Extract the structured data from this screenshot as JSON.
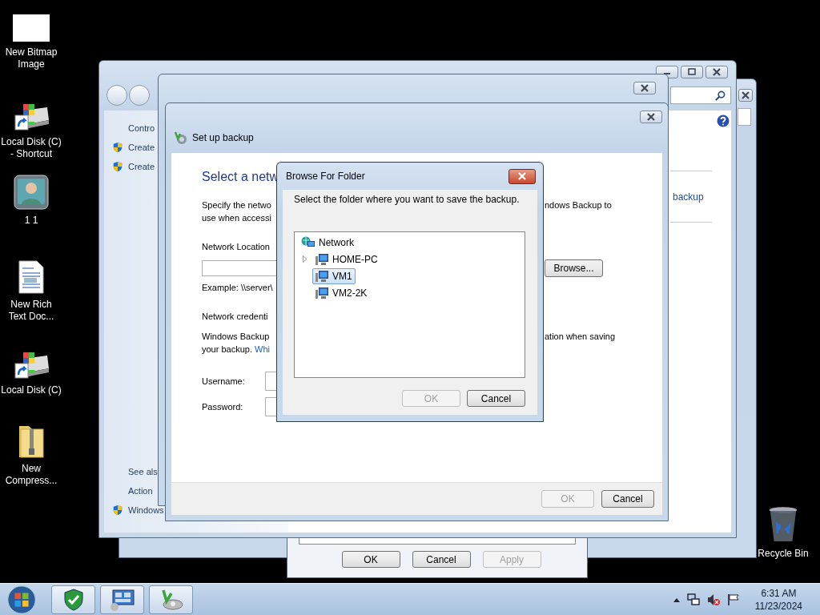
{
  "desktop_icons": [
    {
      "label": "New Bitmap Image",
      "kind": "bitmap"
    },
    {
      "label": "Local Disk (C) - Shortcut",
      "kind": "disk_shortcut"
    },
    {
      "label": "1 1",
      "kind": "user"
    },
    {
      "label": "New Rich Text Doc...",
      "kind": "document"
    },
    {
      "label": "Local Disk (C)",
      "kind": "disk_shortcut"
    },
    {
      "label": "New Compress...",
      "kind": "zip"
    },
    {
      "label": "Recycle Bin",
      "kind": "recycle"
    }
  ],
  "properties_window": {
    "buttons": [
      {
        "label": "OK",
        "disabled": false
      },
      {
        "label": "Cancel",
        "disabled": false
      },
      {
        "label": "Apply",
        "disabled": true
      }
    ]
  },
  "control_panel": {
    "nav_top": [
      {
        "text": "Contro",
        "shield": false
      },
      {
        "text": "Create",
        "shield": true
      },
      {
        "text": "Create",
        "shield": true
      }
    ],
    "nav_bottom": [
      {
        "text": "See als",
        "shield": false
      },
      {
        "text": "Action",
        "shield": false
      },
      {
        "text": "Windows",
        "shield": true
      }
    ],
    "link": "backup"
  },
  "setup_backup": {
    "title": "Set up backup",
    "heading": "Select a netw",
    "rows": [
      {
        "kind": "text",
        "left": "Specify the netwo",
        "right": "ndows Backup to"
      },
      {
        "kind": "text",
        "left": "use when accessi"
      },
      {
        "kind": "label",
        "left": "Network Location"
      },
      {
        "kind": "field_browse",
        "button": "Browse..."
      },
      {
        "kind": "text",
        "left": "Example: \\\\server\\"
      },
      {
        "kind": "label",
        "left": "Network credenti"
      },
      {
        "kind": "text",
        "left": "Windows Backup",
        "right": "ation when saving"
      },
      {
        "kind": "link",
        "left": "your backup.",
        "link": "Whi"
      },
      {
        "kind": "input",
        "left": "Username:"
      },
      {
        "kind": "input",
        "left": "Password:"
      }
    ],
    "buttons": [
      {
        "label": "OK",
        "disabled": true
      },
      {
        "label": "Cancel",
        "disabled": false
      }
    ]
  },
  "browse_dialog": {
    "title": "Browse For Folder",
    "instruction": "Select the folder where you want to save the backup.",
    "tree": {
      "label": "Network",
      "kind": "network",
      "selected": false,
      "children": [
        {
          "label": "HOME-PC",
          "kind": "computer",
          "expandable": true,
          "selected": false
        },
        {
          "label": "VM1",
          "kind": "computer",
          "expandable": false,
          "selected": true
        },
        {
          "label": "VM2-2K",
          "kind": "computer",
          "expandable": false,
          "selected": false
        }
      ]
    },
    "buttons": [
      {
        "label": "OK",
        "disabled": true
      },
      {
        "label": "Cancel",
        "disabled": false
      }
    ]
  },
  "taskbar": {
    "apps": [
      {
        "kind": "security"
      },
      {
        "kind": "remote"
      },
      {
        "kind": "backup"
      }
    ],
    "tray": [
      {
        "kind": "arrow"
      },
      {
        "kind": "network"
      },
      {
        "kind": "volume_muted"
      },
      {
        "kind": "flag"
      }
    ],
    "time": "6:31 AM",
    "date": "11/23/2024"
  }
}
